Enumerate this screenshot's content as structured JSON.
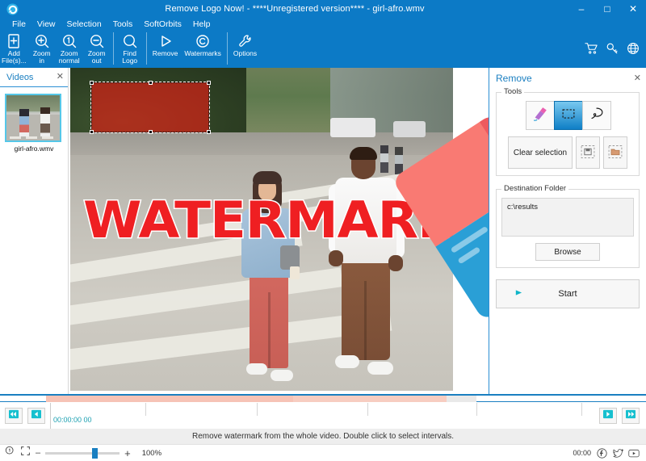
{
  "window": {
    "title": "Remove Logo Now! - ****Unregistered version**** - girl-afro.wmv",
    "logo_icon": "app-logo-icon",
    "minimize": "–",
    "maximize": "□",
    "close": "✕"
  },
  "menu": {
    "items": [
      {
        "label": "File"
      },
      {
        "label": "View"
      },
      {
        "label": "Selection"
      },
      {
        "label": "Tools"
      },
      {
        "label": "SoftOrbits"
      },
      {
        "label": "Help"
      }
    ]
  },
  "toolbar": {
    "buttons": [
      {
        "label": "Add\nFile(s)...",
        "icon": "add-file-icon"
      },
      {
        "label": "Zoom\nin",
        "icon": "zoom-in-icon"
      },
      {
        "label": "Zoom\nnormal",
        "icon": "zoom-normal-icon"
      },
      {
        "label": "Zoom\nout",
        "icon": "zoom-out-icon"
      },
      {
        "label": "Find\nLogo",
        "icon": "find-logo-icon"
      },
      {
        "label": "Remove",
        "icon": "remove-play-icon"
      },
      {
        "label": "Watermarks",
        "icon": "watermarks-copyright-icon"
      },
      {
        "label": "Options",
        "icon": "options-wrench-icon"
      }
    ],
    "right_icons": [
      {
        "name": "cart-icon"
      },
      {
        "name": "key-icon"
      },
      {
        "name": "globe-icon"
      }
    ]
  },
  "videos_panel": {
    "title": "Videos",
    "close": "✕",
    "items": [
      {
        "name": "girl-afro.wmv"
      }
    ]
  },
  "canvas": {
    "watermark_text": "WATERMARK",
    "watermark_color": "#ef1f22",
    "selection": {
      "label": "selection-rectangle",
      "fill_color": "#ed1c14"
    }
  },
  "remove_panel": {
    "title": "Remove",
    "close": "✕",
    "tools_group_label": "Tools",
    "tools": [
      {
        "name": "marker-tool",
        "icon": "marker-eraser-icon",
        "active": false
      },
      {
        "name": "rectangle-select-tool",
        "icon": "rectangle-select-icon",
        "active": true
      },
      {
        "name": "lasso-select-tool",
        "icon": "lasso-icon",
        "active": false
      }
    ],
    "clear_selection_label": "Clear selection",
    "save_selection_icon": "save-selection-icon",
    "load_selection_icon": "load-selection-icon",
    "destination_group_label": "Destination Folder",
    "destination_path": "c:\\results",
    "browse_label": "Browse",
    "start_label": "Start",
    "start_arrow_icon": "arrow-right-icon",
    "accent_color": "#1a7fc1"
  },
  "timeline": {
    "timecode": "00:00:00 00",
    "skip_start_icon": "skip-to-start-icon",
    "step_back_icon": "step-back-icon",
    "play_icon": "play-icon",
    "skip_end_icon": "skip-to-end-icon"
  },
  "status": {
    "message": "Remove watermark from the whole video. Double click to select intervals."
  },
  "bottom_bar": {
    "zoom_reset_icon": "zoom-reset-icon",
    "fit_screen_icon": "fit-to-screen-icon",
    "minus": "–",
    "plus": "+",
    "zoom_level": "100%",
    "duration": "00:00",
    "facebook_icon": "facebook-icon",
    "twitter_icon": "twitter-icon",
    "youtube_icon": "youtube-icon"
  }
}
